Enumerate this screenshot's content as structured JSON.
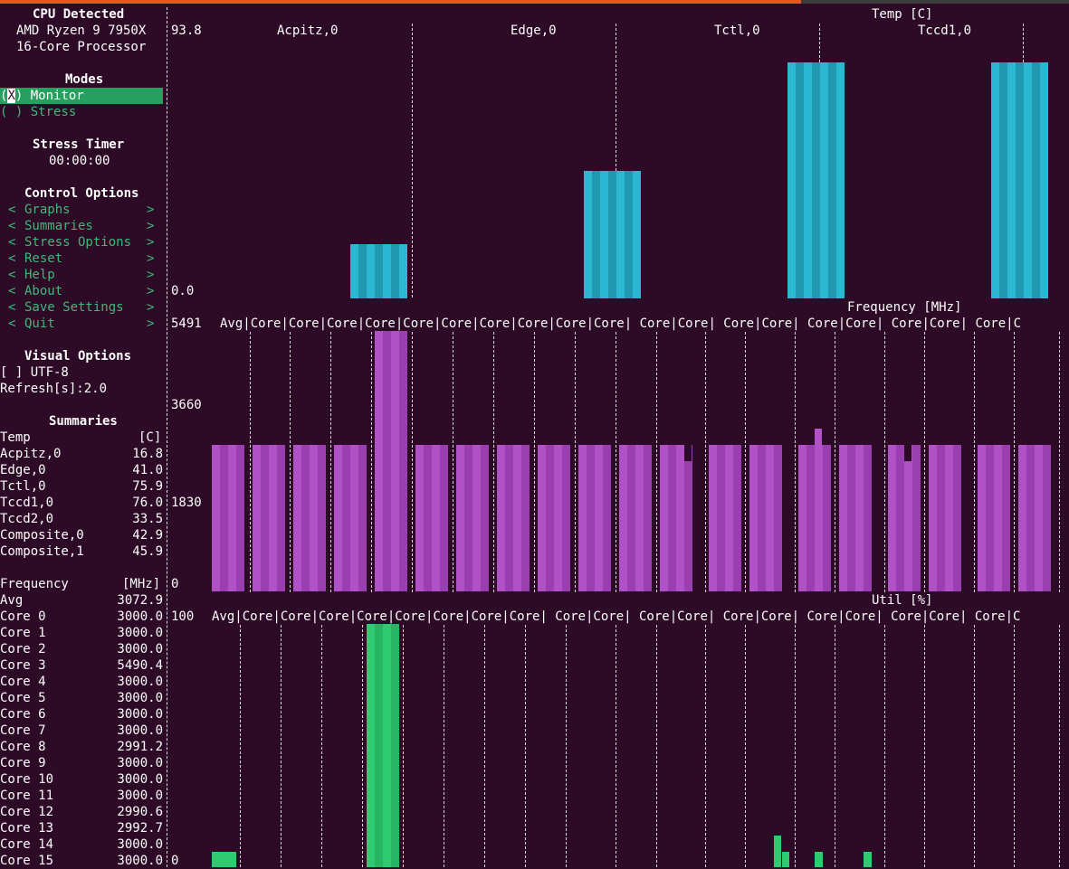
{
  "sidebar": {
    "cpu_title": "CPU Detected",
    "cpu_line1": "AMD Ryzen 9 7950X",
    "cpu_line2": "16-Core Processor",
    "modes_title": "Modes",
    "mode_monitor": "Monitor",
    "mode_stress": "( ) Stress",
    "timer_title": "Stress Timer",
    "timer_value": "00:00:00",
    "control_title": "Control Options",
    "controls": [
      {
        "label": "Graphs"
      },
      {
        "label": "Summaries"
      },
      {
        "label": "Stress Options"
      },
      {
        "label": "Reset"
      },
      {
        "label": "Help"
      },
      {
        "label": "About"
      },
      {
        "label": "Save Settings"
      },
      {
        "label": "Quit"
      }
    ],
    "visual_title": "Visual Options",
    "utf8": "[ ] UTF-8",
    "refresh": "Refresh[s]:2.0"
  },
  "summaries": {
    "title": "Summaries",
    "temp_header": "Temp",
    "temp_unit": "[C]",
    "temps": [
      {
        "name": "Acpitz,0",
        "value": "16.8"
      },
      {
        "name": "Edge,0",
        "value": "41.0"
      },
      {
        "name": "Tctl,0",
        "value": "75.9"
      },
      {
        "name": "Tccd1,0",
        "value": "76.0"
      },
      {
        "name": "Tccd2,0",
        "value": "33.5"
      },
      {
        "name": "Composite,0",
        "value": "42.9"
      },
      {
        "name": "Composite,1",
        "value": "45.9"
      }
    ],
    "freq_header": "Frequency",
    "freq_unit": "[MHz]",
    "freqs": [
      {
        "name": "Avg",
        "value": "3072.9"
      },
      {
        "name": "Core 0",
        "value": "3000.0"
      },
      {
        "name": "Core 1",
        "value": "3000.0"
      },
      {
        "name": "Core 2",
        "value": "3000.0"
      },
      {
        "name": "Core 3",
        "value": "5490.4"
      },
      {
        "name": "Core 4",
        "value": "3000.0"
      },
      {
        "name": "Core 5",
        "value": "3000.0"
      },
      {
        "name": "Core 6",
        "value": "3000.0"
      },
      {
        "name": "Core 7",
        "value": "3000.0"
      },
      {
        "name": "Core 8",
        "value": "2991.2"
      },
      {
        "name": "Core 9",
        "value": "3000.0"
      },
      {
        "name": "Core 10",
        "value": "3000.0"
      },
      {
        "name": "Core 11",
        "value": "3000.0"
      },
      {
        "name": "Core 12",
        "value": "2990.6"
      },
      {
        "name": "Core 13",
        "value": "2992.7"
      },
      {
        "name": "Core 14",
        "value": "3000.0"
      },
      {
        "name": "Core 15",
        "value": "3000.0"
      }
    ]
  },
  "graphs": {
    "temp": {
      "title": "Temp [C]",
      "y_max": "93.8",
      "y_min": "0.0",
      "color_a": "#2ab7d1",
      "color_b": "#1f98b0",
      "columns": [
        {
          "label": "Acpitz,0",
          "fraction": 0.2
        },
        {
          "label": "Edge,0",
          "fraction": 0.47
        },
        {
          "label": "Tctl,0",
          "fraction": 0.87
        },
        {
          "label": "Tccd1,0",
          "fraction": 0.87
        }
      ]
    },
    "freq": {
      "title": "Frequency [MHz]",
      "y_max": "5491",
      "y_mid": "3660",
      "y_low": "1830",
      "y_min": "0",
      "color_a": "#b151c7",
      "color_b": "#9a3fb0",
      "header": "Avg|Core|Core|Core|Core|Core|Core|Core|Core|Core|Core| Core|Core| Core|Core| Core|Core| Core|Core| Core|C"
    },
    "util": {
      "title": "Util [%]",
      "y_max": "100",
      "y_min": "0",
      "color": "#2ecc71",
      "header": "Avg|Core|Core|Core|Core|Core|Core|Core|Core| Core|Core| Core|Core| Core|Core| Core|Core| Core|Core| Core|C"
    }
  }
}
